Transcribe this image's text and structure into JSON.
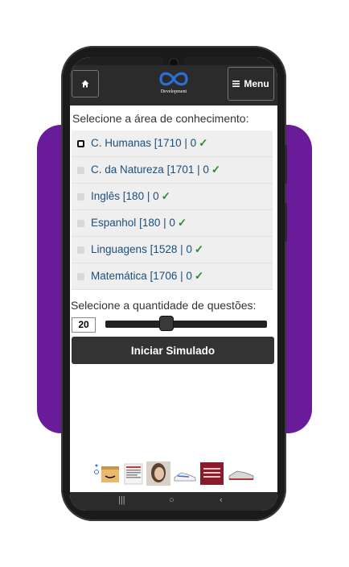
{
  "header": {
    "home_icon": "home-icon",
    "logo_text": "Development",
    "menu_label": "Menu",
    "menu_icon": "hamburger-icon"
  },
  "main": {
    "area_label": "Selecione a área de conhecimento:",
    "areas": [
      {
        "name": "C. Humanas",
        "count": "[1710 | 0",
        "check": "✓",
        "checked": true
      },
      {
        "name": "C. da Natureza",
        "count": "[1701 | 0",
        "check": "✓",
        "checked": false
      },
      {
        "name": "Inglês",
        "count": "[180 | 0",
        "check": "✓",
        "checked": false
      },
      {
        "name": "Espanhol",
        "count": "[180 | 0",
        "check": "✓",
        "checked": false
      },
      {
        "name": "Linguagens",
        "count": "[1528 | 0",
        "check": "✓",
        "checked": false
      },
      {
        "name": "Matemática",
        "count": "[1706 | 0",
        "check": "✓",
        "checked": false
      }
    ],
    "quantity_label": "Selecione a quantidade de questões:",
    "quantity_value": "20",
    "quantity_level": 0.38,
    "start_button": "Iniciar Simulado"
  },
  "colors": {
    "background_accent": "#6a1b9a",
    "header": "#2b2b2b",
    "link_text": "#1b4f7c",
    "check": "#2e8b2e"
  }
}
